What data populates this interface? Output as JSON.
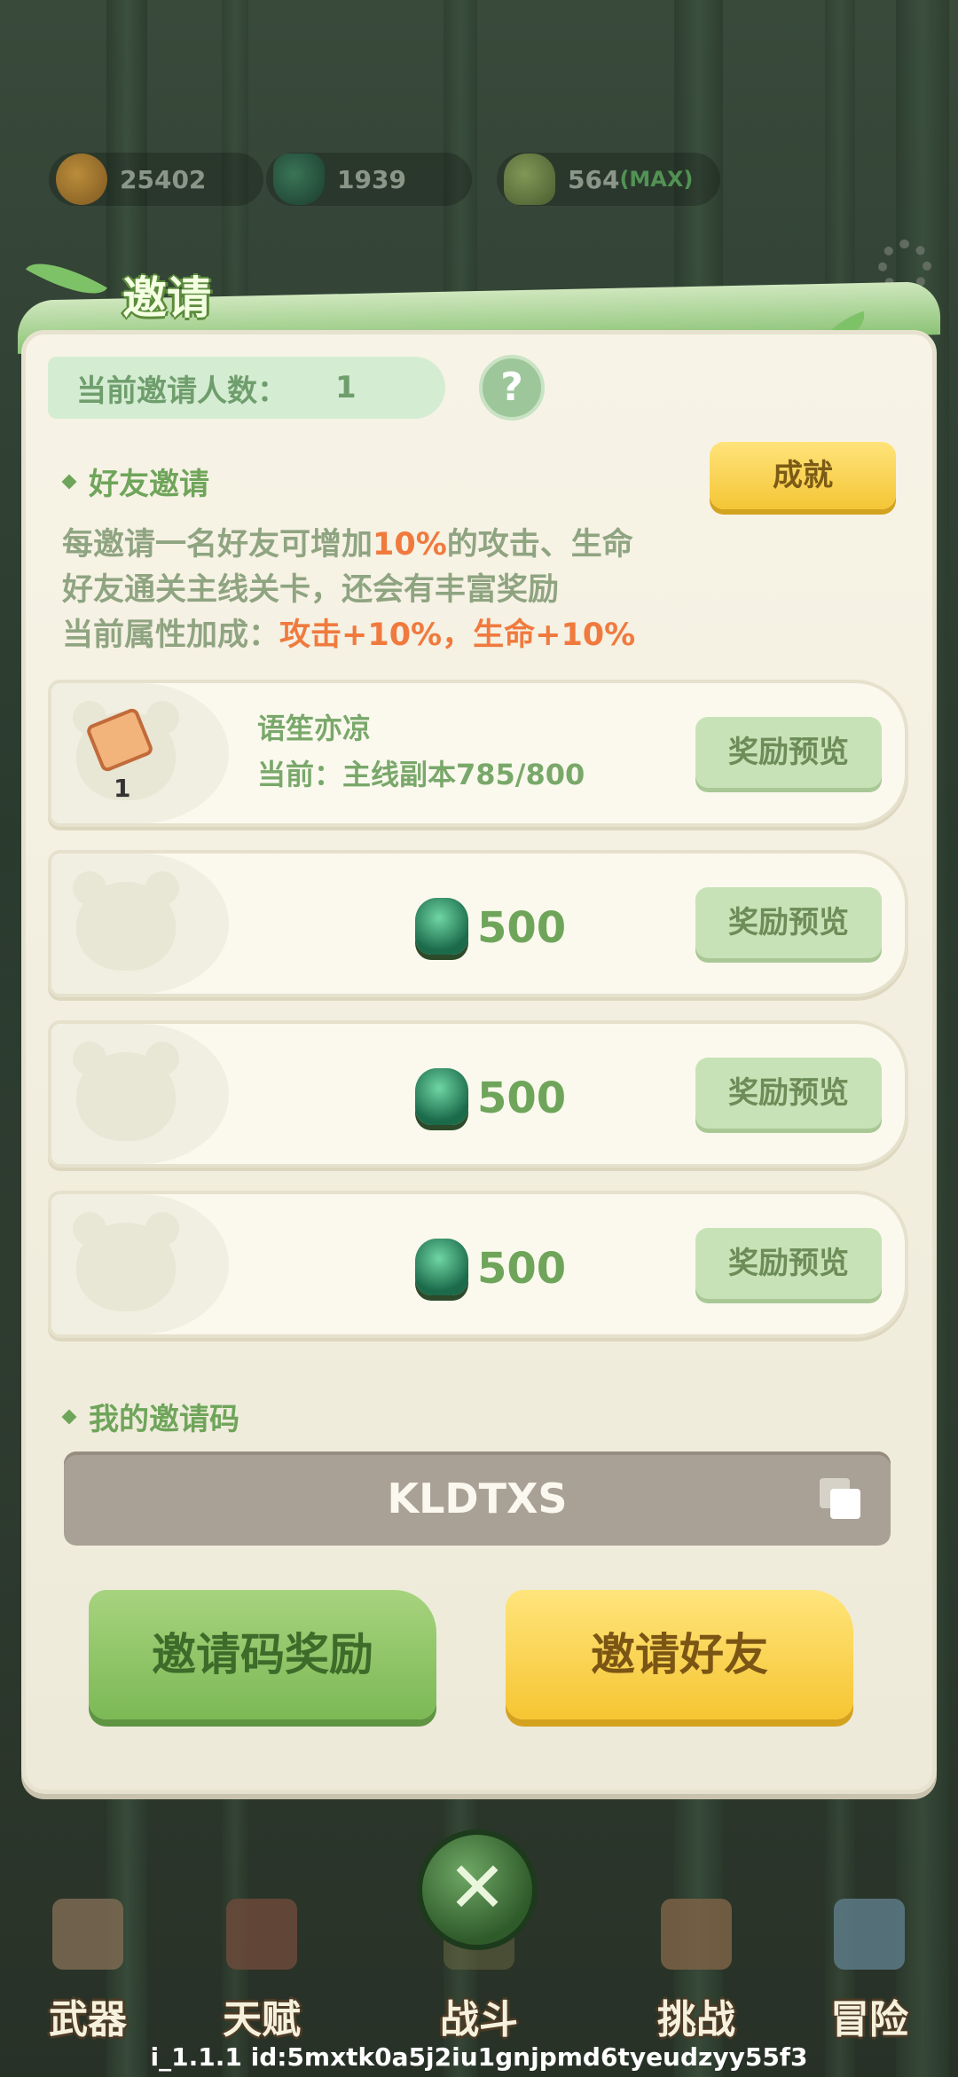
{
  "resources": {
    "paw_coins": "25402",
    "gems": "1939",
    "shoots": "564",
    "shoots_max": "(MAX)"
  },
  "panel": {
    "title": "邀请",
    "invite_count_label": "当前邀请人数：",
    "invite_count_value": "1",
    "help_label": "?",
    "friend_section_title": "好友邀请",
    "achievement_button": "成就",
    "desc_line1_pre": "每邀请一名好友可增加",
    "desc_line1_hl": "10%",
    "desc_line1_post": "的攻击、生命",
    "desc_line2": "好友通关主线关卡，还会有丰富奖励",
    "desc_line3_pre": "当前属性加成：",
    "desc_line3_hl": "攻击+10%，生命+10%"
  },
  "rows": [
    {
      "ticket_count": "1",
      "name": "语笙亦凉",
      "progress": "当前：主线副本785/800",
      "button": "奖励预览"
    },
    {
      "reward_amount": "500",
      "button": "奖励预览"
    },
    {
      "reward_amount": "500",
      "button": "奖励预览"
    },
    {
      "reward_amount": "500",
      "button": "奖励预览"
    }
  ],
  "invite_code": {
    "section_title": "我的邀请码",
    "code": "KLDTXS"
  },
  "buttons": {
    "code_reward": "邀请码奖励",
    "invite_friend": "邀请好友",
    "close": "✕"
  },
  "nav": [
    {
      "label": "武器",
      "icon": "axe-icon"
    },
    {
      "label": "天赋",
      "icon": "book-icon"
    },
    {
      "label": "战斗",
      "icon": "scroll-icon"
    },
    {
      "label": "挑战",
      "icon": "stump-icon"
    },
    {
      "label": "冒险",
      "icon": "map-icon"
    }
  ],
  "version_text": "i_1.1.1 id:5mxtk0a5j2iu1gnjpmd6tyeudzyy55f3"
}
